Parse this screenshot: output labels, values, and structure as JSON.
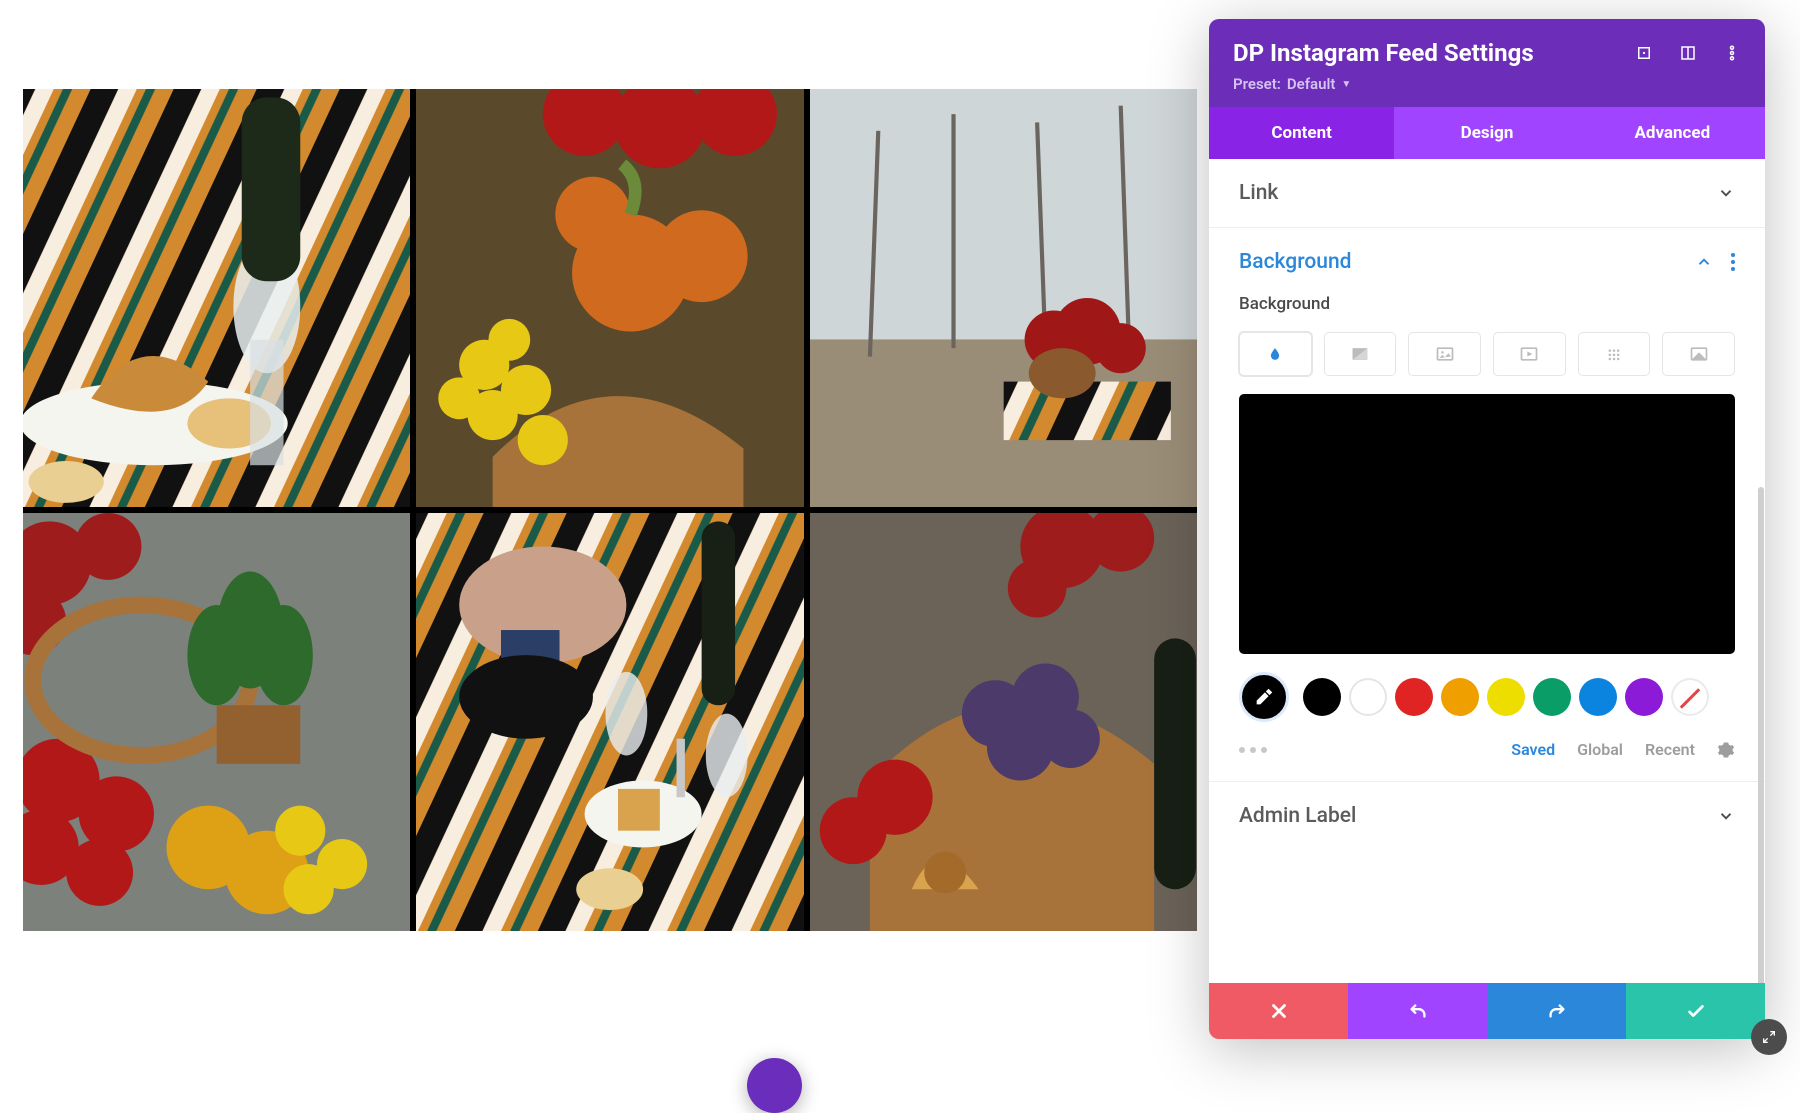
{
  "header": {
    "title": "DP Instagram Feed Settings",
    "preset_prefix": "Preset:",
    "preset_value": "Default"
  },
  "tabs": [
    "Content",
    "Design",
    "Advanced"
  ],
  "active_tab": 0,
  "sections": {
    "link": {
      "title": "Link",
      "open": false
    },
    "background": {
      "title": "Background",
      "open": true,
      "sublabel": "Background",
      "bg_tabs": [
        "color",
        "gradient",
        "image",
        "video",
        "pattern",
        "mask"
      ],
      "active_bg_tab": 0,
      "preview_color": "#000000",
      "palette": [
        {
          "kind": "eyedropper"
        },
        {
          "color": "#000000"
        },
        {
          "color": "#ffffff",
          "outline": true
        },
        {
          "color": "#e02424"
        },
        {
          "color": "#ef9f00"
        },
        {
          "color": "#edde00"
        },
        {
          "color": "#0a9d67"
        },
        {
          "color": "#0b84e0"
        },
        {
          "color": "#8c1bd8"
        },
        {
          "kind": "none"
        }
      ],
      "footer_links": [
        "Saved",
        "Global",
        "Recent"
      ],
      "active_footer_link": 0
    },
    "admin": {
      "title": "Admin Label",
      "open": false
    }
  },
  "footer_buttons": [
    "cancel",
    "undo",
    "redo",
    "save"
  ]
}
